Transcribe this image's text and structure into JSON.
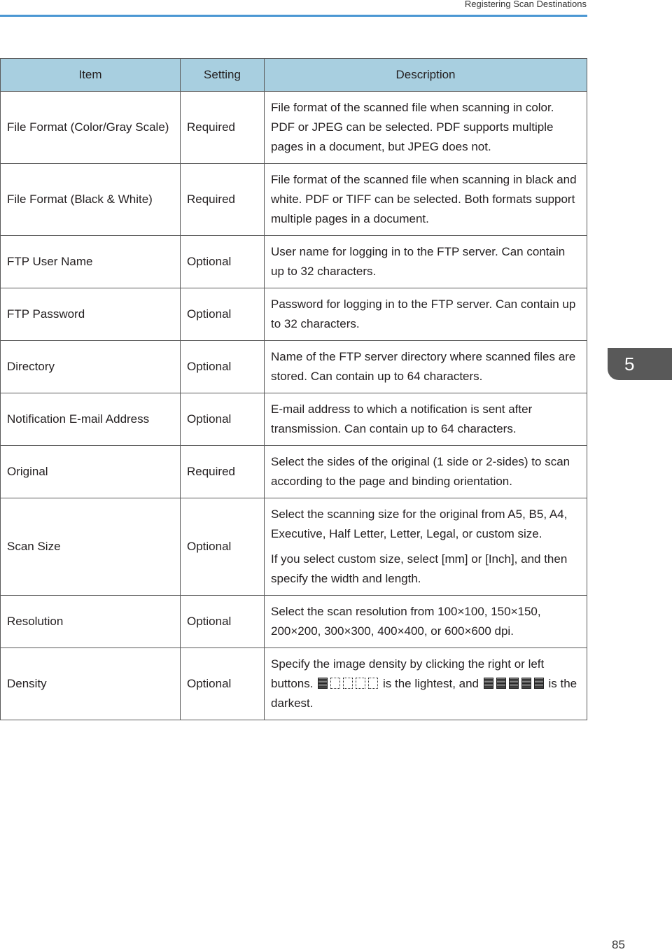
{
  "running_header": "Registering Scan Destinations",
  "table": {
    "columns": [
      "Item",
      "Setting",
      "Description"
    ],
    "rows": [
      {
        "item": "File Format (Color/Gray Scale)",
        "setting": "Required",
        "description": [
          "File format of the scanned file when scanning in color. PDF or JPEG can be selected. PDF supports multiple pages in a document, but JPEG does not."
        ]
      },
      {
        "item": "File Format (Black & White)",
        "setting": "Required",
        "description": [
          "File format of the scanned file when scanning in black and white. PDF or TIFF can be selected. Both formats support multiple pages in a document."
        ]
      },
      {
        "item": "FTP User Name",
        "setting": "Optional",
        "description": [
          "User name for logging in to the FTP server. Can contain up to 32 characters."
        ]
      },
      {
        "item": "FTP Password",
        "setting": "Optional",
        "description": [
          "Password for logging in to the FTP server. Can contain up to 32 characters."
        ]
      },
      {
        "item": "Directory",
        "setting": "Optional",
        "description": [
          "Name of the FTP server directory where scanned files are stored. Can contain up to 64 characters."
        ]
      },
      {
        "item": "Notification E-mail Address",
        "setting": "Optional",
        "description": [
          "E-mail address to which a notification is sent after transmission. Can contain up to 64 characters."
        ]
      },
      {
        "item": "Original",
        "setting": "Required",
        "description": [
          "Select the sides of the original (1 side or 2-sides) to scan according to the page and binding orientation."
        ]
      },
      {
        "item": "Scan Size",
        "setting": "Optional",
        "description": [
          "Select the scanning size for the original from A5, B5, A4, Executive, Half Letter, Letter, Legal, or custom size.",
          "If you select custom size, select [mm] or [Inch], and then specify the width and length."
        ]
      },
      {
        "item": "Resolution",
        "setting": "Optional",
        "description": [
          "Select the scan resolution from 100×100, 150×150, 200×200, 300×300, 400×400, or 600×600 dpi."
        ]
      },
      {
        "item": "Density",
        "setting": "Optional",
        "density_text": {
          "before": "Specify the image density by clicking the right or left buttons.",
          "middle": "is the lightest, and",
          "after": "is the darkest."
        },
        "density_lightest_level": 1,
        "density_darkest_level": 5,
        "density_total_levels": 5
      }
    ]
  },
  "chapter_tab": "5",
  "page_number": "85"
}
